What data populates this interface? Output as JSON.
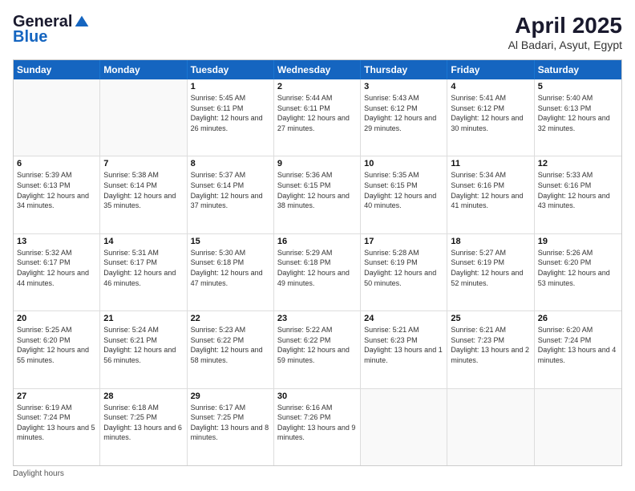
{
  "header": {
    "logo_general": "General",
    "logo_blue": "Blue",
    "month_title": "April 2025",
    "location": "Al Badari, Asyut, Egypt"
  },
  "days_of_week": [
    "Sunday",
    "Monday",
    "Tuesday",
    "Wednesday",
    "Thursday",
    "Friday",
    "Saturday"
  ],
  "weeks": [
    [
      {
        "day": "",
        "sunrise": "",
        "sunset": "",
        "daylight": ""
      },
      {
        "day": "",
        "sunrise": "",
        "sunset": "",
        "daylight": ""
      },
      {
        "day": "1",
        "sunrise": "Sunrise: 5:45 AM",
        "sunset": "Sunset: 6:11 PM",
        "daylight": "Daylight: 12 hours and 26 minutes."
      },
      {
        "day": "2",
        "sunrise": "Sunrise: 5:44 AM",
        "sunset": "Sunset: 6:11 PM",
        "daylight": "Daylight: 12 hours and 27 minutes."
      },
      {
        "day": "3",
        "sunrise": "Sunrise: 5:43 AM",
        "sunset": "Sunset: 6:12 PM",
        "daylight": "Daylight: 12 hours and 29 minutes."
      },
      {
        "day": "4",
        "sunrise": "Sunrise: 5:41 AM",
        "sunset": "Sunset: 6:12 PM",
        "daylight": "Daylight: 12 hours and 30 minutes."
      },
      {
        "day": "5",
        "sunrise": "Sunrise: 5:40 AM",
        "sunset": "Sunset: 6:13 PM",
        "daylight": "Daylight: 12 hours and 32 minutes."
      }
    ],
    [
      {
        "day": "6",
        "sunrise": "Sunrise: 5:39 AM",
        "sunset": "Sunset: 6:13 PM",
        "daylight": "Daylight: 12 hours and 34 minutes."
      },
      {
        "day": "7",
        "sunrise": "Sunrise: 5:38 AM",
        "sunset": "Sunset: 6:14 PM",
        "daylight": "Daylight: 12 hours and 35 minutes."
      },
      {
        "day": "8",
        "sunrise": "Sunrise: 5:37 AM",
        "sunset": "Sunset: 6:14 PM",
        "daylight": "Daylight: 12 hours and 37 minutes."
      },
      {
        "day": "9",
        "sunrise": "Sunrise: 5:36 AM",
        "sunset": "Sunset: 6:15 PM",
        "daylight": "Daylight: 12 hours and 38 minutes."
      },
      {
        "day": "10",
        "sunrise": "Sunrise: 5:35 AM",
        "sunset": "Sunset: 6:15 PM",
        "daylight": "Daylight: 12 hours and 40 minutes."
      },
      {
        "day": "11",
        "sunrise": "Sunrise: 5:34 AM",
        "sunset": "Sunset: 6:16 PM",
        "daylight": "Daylight: 12 hours and 41 minutes."
      },
      {
        "day": "12",
        "sunrise": "Sunrise: 5:33 AM",
        "sunset": "Sunset: 6:16 PM",
        "daylight": "Daylight: 12 hours and 43 minutes."
      }
    ],
    [
      {
        "day": "13",
        "sunrise": "Sunrise: 5:32 AM",
        "sunset": "Sunset: 6:17 PM",
        "daylight": "Daylight: 12 hours and 44 minutes."
      },
      {
        "day": "14",
        "sunrise": "Sunrise: 5:31 AM",
        "sunset": "Sunset: 6:17 PM",
        "daylight": "Daylight: 12 hours and 46 minutes."
      },
      {
        "day": "15",
        "sunrise": "Sunrise: 5:30 AM",
        "sunset": "Sunset: 6:18 PM",
        "daylight": "Daylight: 12 hours and 47 minutes."
      },
      {
        "day": "16",
        "sunrise": "Sunrise: 5:29 AM",
        "sunset": "Sunset: 6:18 PM",
        "daylight": "Daylight: 12 hours and 49 minutes."
      },
      {
        "day": "17",
        "sunrise": "Sunrise: 5:28 AM",
        "sunset": "Sunset: 6:19 PM",
        "daylight": "Daylight: 12 hours and 50 minutes."
      },
      {
        "day": "18",
        "sunrise": "Sunrise: 5:27 AM",
        "sunset": "Sunset: 6:19 PM",
        "daylight": "Daylight: 12 hours and 52 minutes."
      },
      {
        "day": "19",
        "sunrise": "Sunrise: 5:26 AM",
        "sunset": "Sunset: 6:20 PM",
        "daylight": "Daylight: 12 hours and 53 minutes."
      }
    ],
    [
      {
        "day": "20",
        "sunrise": "Sunrise: 5:25 AM",
        "sunset": "Sunset: 6:20 PM",
        "daylight": "Daylight: 12 hours and 55 minutes."
      },
      {
        "day": "21",
        "sunrise": "Sunrise: 5:24 AM",
        "sunset": "Sunset: 6:21 PM",
        "daylight": "Daylight: 12 hours and 56 minutes."
      },
      {
        "day": "22",
        "sunrise": "Sunrise: 5:23 AM",
        "sunset": "Sunset: 6:22 PM",
        "daylight": "Daylight: 12 hours and 58 minutes."
      },
      {
        "day": "23",
        "sunrise": "Sunrise: 5:22 AM",
        "sunset": "Sunset: 6:22 PM",
        "daylight": "Daylight: 12 hours and 59 minutes."
      },
      {
        "day": "24",
        "sunrise": "Sunrise: 5:21 AM",
        "sunset": "Sunset: 6:23 PM",
        "daylight": "Daylight: 13 hours and 1 minute."
      },
      {
        "day": "25",
        "sunrise": "Sunrise: 6:21 AM",
        "sunset": "Sunset: 7:23 PM",
        "daylight": "Daylight: 13 hours and 2 minutes."
      },
      {
        "day": "26",
        "sunrise": "Sunrise: 6:20 AM",
        "sunset": "Sunset: 7:24 PM",
        "daylight": "Daylight: 13 hours and 4 minutes."
      }
    ],
    [
      {
        "day": "27",
        "sunrise": "Sunrise: 6:19 AM",
        "sunset": "Sunset: 7:24 PM",
        "daylight": "Daylight: 13 hours and 5 minutes."
      },
      {
        "day": "28",
        "sunrise": "Sunrise: 6:18 AM",
        "sunset": "Sunset: 7:25 PM",
        "daylight": "Daylight: 13 hours and 6 minutes."
      },
      {
        "day": "29",
        "sunrise": "Sunrise: 6:17 AM",
        "sunset": "Sunset: 7:25 PM",
        "daylight": "Daylight: 13 hours and 8 minutes."
      },
      {
        "day": "30",
        "sunrise": "Sunrise: 6:16 AM",
        "sunset": "Sunset: 7:26 PM",
        "daylight": "Daylight: 13 hours and 9 minutes."
      },
      {
        "day": "",
        "sunrise": "",
        "sunset": "",
        "daylight": ""
      },
      {
        "day": "",
        "sunrise": "",
        "sunset": "",
        "daylight": ""
      },
      {
        "day": "",
        "sunrise": "",
        "sunset": "",
        "daylight": ""
      }
    ]
  ],
  "footer": {
    "daylight_hours_label": "Daylight hours"
  }
}
